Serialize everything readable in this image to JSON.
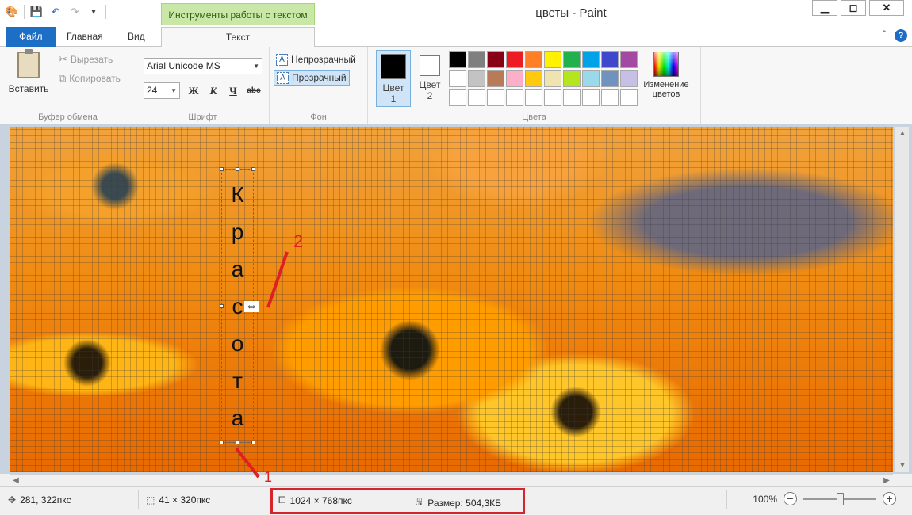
{
  "window": {
    "title": "цветы - Paint",
    "contextual_tab": "Инструменты работы с текстом"
  },
  "tabs": [
    {
      "label": "Файл"
    },
    {
      "label": "Главная"
    },
    {
      "label": "Вид"
    },
    {
      "label": "Текст"
    }
  ],
  "ribbon": {
    "clipboard": {
      "paste": "Вставить",
      "cut": "Вырезать",
      "copy": "Копировать",
      "group": "Буфер обмена"
    },
    "font": {
      "family": "Arial Unicode MS",
      "size": "24",
      "bold": "Ж",
      "italic": "К",
      "underline": "Ч",
      "strike": "abc",
      "group": "Шрифт"
    },
    "background": {
      "opaque": "Непрозрачный",
      "transparent": "Прозрачный",
      "group": "Фон"
    },
    "colors": {
      "color1_label": "Цвет",
      "color1_num": "1",
      "color1_value": "#000000",
      "color2_label": "Цвет",
      "color2_num": "2",
      "color2_value": "#ffffff",
      "edit_line1": "Изменение",
      "edit_line2": "цветов",
      "group": "Цвета",
      "palette": [
        "#000000",
        "#7f7f7f",
        "#880015",
        "#ed1c24",
        "#ff7f27",
        "#fff200",
        "#22b14c",
        "#00a2e8",
        "#3f48cc",
        "#a349a4",
        "#ffffff",
        "#c3c3c3",
        "#b97a57",
        "#ffaec9",
        "#ffc90e",
        "#efe4b0",
        "#b5e61d",
        "#99d9ea",
        "#7092be",
        "#c8bfe7",
        "#ffffff",
        "#ffffff",
        "#ffffff",
        "#ffffff",
        "#ffffff",
        "#ffffff",
        "#ffffff",
        "#ffffff",
        "#ffffff",
        "#ffffff"
      ]
    }
  },
  "canvas": {
    "text_letters": [
      "К",
      "р",
      "а",
      "с",
      "о",
      "т",
      "а"
    ],
    "marker1": "1",
    "marker2": "2"
  },
  "statusbar": {
    "cursor_pos": "281, 322пкс",
    "selection_size": "41 × 320пкс",
    "image_size": "1024 × 768пкс",
    "file_size": "Размер: 504,3КБ",
    "zoom": "100%",
    "zoom_level": 0.5
  }
}
